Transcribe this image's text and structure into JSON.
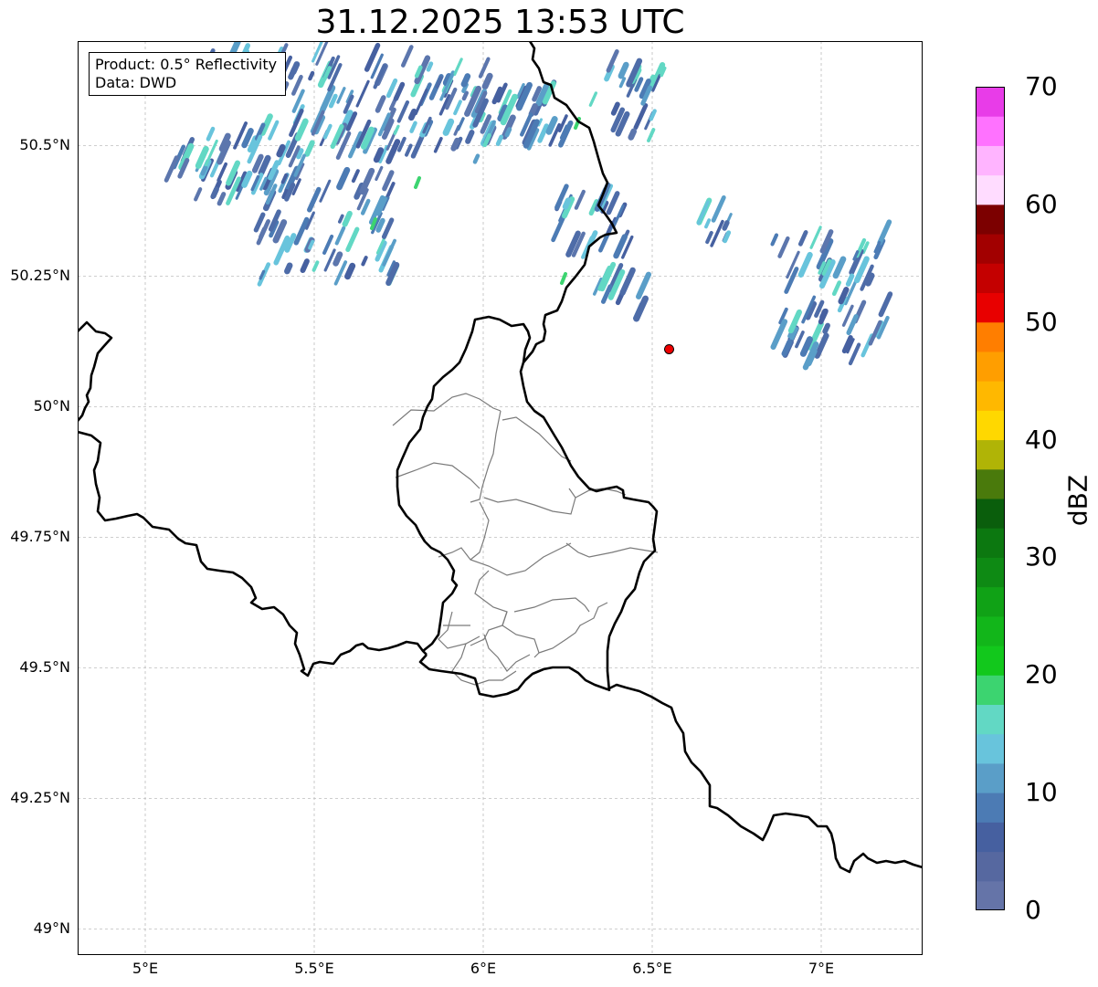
{
  "map": {
    "title": "31.12.2025 13:53 UTC",
    "info_box": {
      "line1": "Product: 0.5° Reflectivity",
      "line2": "Data: DWD"
    },
    "extent": {
      "lon": [
        4.8,
        7.3
      ],
      "lat": [
        48.95,
        50.7
      ]
    },
    "x_ticks": [
      {
        "value": 5.0,
        "label": "5°E"
      },
      {
        "value": 5.5,
        "label": "5.5°E"
      },
      {
        "value": 6.0,
        "label": "6°E"
      },
      {
        "value": 6.5,
        "label": "6.5°E"
      },
      {
        "value": 7.0,
        "label": "7°E"
      }
    ],
    "y_ticks": [
      {
        "value": 50.5,
        "label": "50.5°N"
      },
      {
        "value": 50.25,
        "label": "50.25°N"
      },
      {
        "value": 50.0,
        "label": "50°N"
      },
      {
        "value": 49.75,
        "label": "49.75°N"
      },
      {
        "value": 49.5,
        "label": "49.5°N"
      },
      {
        "value": 49.25,
        "label": "49.25°N"
      },
      {
        "value": 49.0,
        "label": "49°N"
      }
    ],
    "radar_site_marker": {
      "lon": 6.55,
      "lat": 50.11,
      "color": "#ee0000"
    },
    "colorbar": {
      "label": "dBZ",
      "min": 0,
      "max": 70,
      "ticks": [
        "0",
        "10",
        "20",
        "30",
        "40",
        "50",
        "60",
        "70"
      ],
      "colors": [
        "#6574a8",
        "#5668a0",
        "#4660a0",
        "#4c7bb4",
        "#5a9ec8",
        "#68c4dc",
        "#62d8c4",
        "#3cd470",
        "#12c81c",
        "#12b61a",
        "#10a216",
        "#0e8a14",
        "#0c7810",
        "#0a5e0c",
        "#4a7a0c",
        "#b0b406",
        "#ffd800",
        "#ffb800",
        "#ff9e00",
        "#ff7e00",
        "#e80000",
        "#c40000",
        "#a20000",
        "#7c0000",
        "#ffdcff",
        "#ffb4ff",
        "#ff72ff",
        "#e83ce8"
      ]
    }
  }
}
